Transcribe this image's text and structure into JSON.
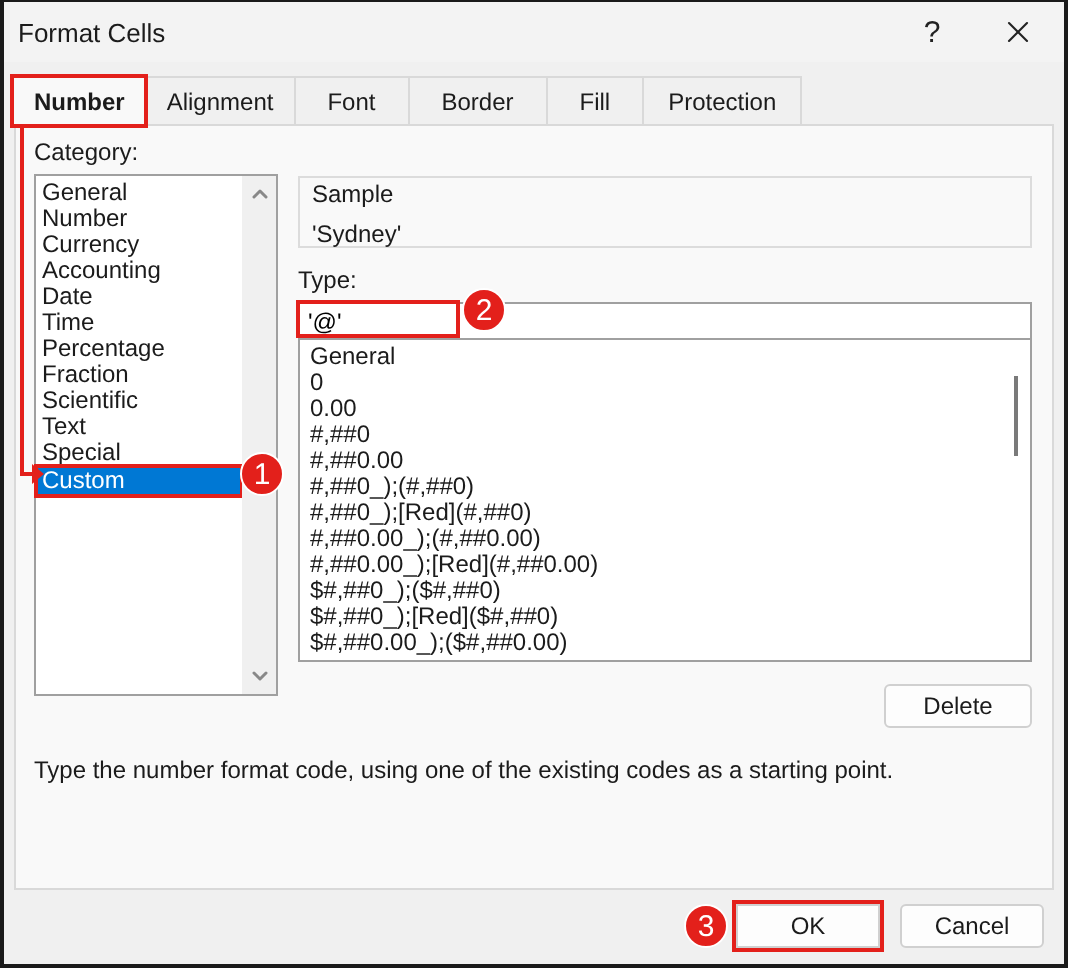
{
  "window": {
    "title": "Format Cells",
    "help": "?"
  },
  "tabs": [
    {
      "label": "Number",
      "selected": true,
      "highlighted": true
    },
    {
      "label": "Alignment",
      "selected": false,
      "highlighted": false
    },
    {
      "label": "Font",
      "selected": false,
      "highlighted": false
    },
    {
      "label": "Border",
      "selected": false,
      "highlighted": false
    },
    {
      "label": "Fill",
      "selected": false,
      "highlighted": false
    },
    {
      "label": "Protection",
      "selected": false,
      "highlighted": false
    }
  ],
  "category": {
    "label": "Category:",
    "callout": "1",
    "items": [
      {
        "label": "General",
        "selected": false,
        "highlighted": false
      },
      {
        "label": "Number",
        "selected": false,
        "highlighted": false
      },
      {
        "label": "Currency",
        "selected": false,
        "highlighted": false
      },
      {
        "label": "Accounting",
        "selected": false,
        "highlighted": false
      },
      {
        "label": "Date",
        "selected": false,
        "highlighted": false
      },
      {
        "label": "Time",
        "selected": false,
        "highlighted": false
      },
      {
        "label": "Percentage",
        "selected": false,
        "highlighted": false
      },
      {
        "label": "Fraction",
        "selected": false,
        "highlighted": false
      },
      {
        "label": "Scientific",
        "selected": false,
        "highlighted": false
      },
      {
        "label": "Text",
        "selected": false,
        "highlighted": false
      },
      {
        "label": "Special",
        "selected": false,
        "highlighted": false
      },
      {
        "label": "Custom",
        "selected": true,
        "highlighted": true
      }
    ]
  },
  "annotation_arrow": true,
  "sample": {
    "label": "Sample",
    "value": "'Sydney'"
  },
  "type": {
    "label": "Type:",
    "value": "'@'",
    "highlighted": true,
    "callout": "2",
    "items": [
      "General",
      "0",
      "0.00",
      "#,##0",
      "#,##0.00",
      "#,##0_);(#,##0)",
      "#,##0_);[Red](#,##0)",
      "#,##0.00_);(#,##0.00)",
      "#,##0.00_);[Red](#,##0.00)",
      "$#,##0_);($#,##0)",
      "$#,##0_);[Red]($#,##0)",
      "$#,##0.00_);($#,##0.00)"
    ]
  },
  "delete_button": "Delete",
  "description": "Type the number format code, using one of the existing codes as a starting point.",
  "buttons": [
    {
      "label": "OK",
      "highlighted": true,
      "callout": "3"
    },
    {
      "label": "Cancel",
      "highlighted": false
    }
  ]
}
